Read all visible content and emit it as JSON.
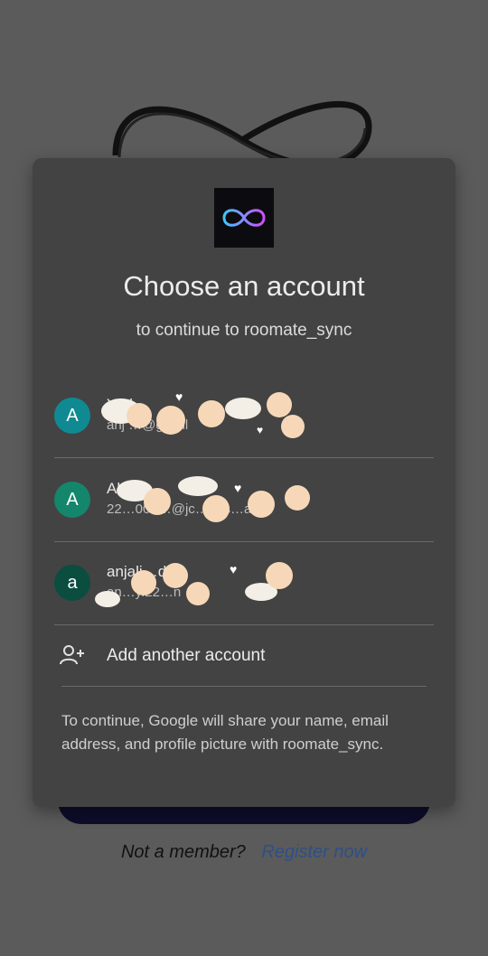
{
  "background": {
    "footer_question": "Not a member?",
    "footer_link": "Register now"
  },
  "dialog": {
    "title": "Choose an account",
    "subtitle": "to continue to roomate_sync",
    "accounts": [
      {
        "initial": "A",
        "name": "Yad",
        "email": "anj …@gmail",
        "avatar_color": "#0f8a92"
      },
      {
        "initial": "A",
        "name": "Ab",
        "email": "22…003…@jc…eus…ac.in",
        "avatar_color": "#14866b"
      },
      {
        "initial": "a",
        "name": "anjali…dav",
        "email": "an…y.22…n",
        "avatar_color": "#0b4d3f"
      }
    ],
    "add_account_label": "Add another account",
    "add_account_icon": "add-person-icon",
    "notice": "To continue, Google will share your name, email address, and profile picture with roomate_sync."
  },
  "colors": {
    "scrim": "#5b5b5b",
    "dialog": "#434343",
    "link": "#2e4f87"
  }
}
